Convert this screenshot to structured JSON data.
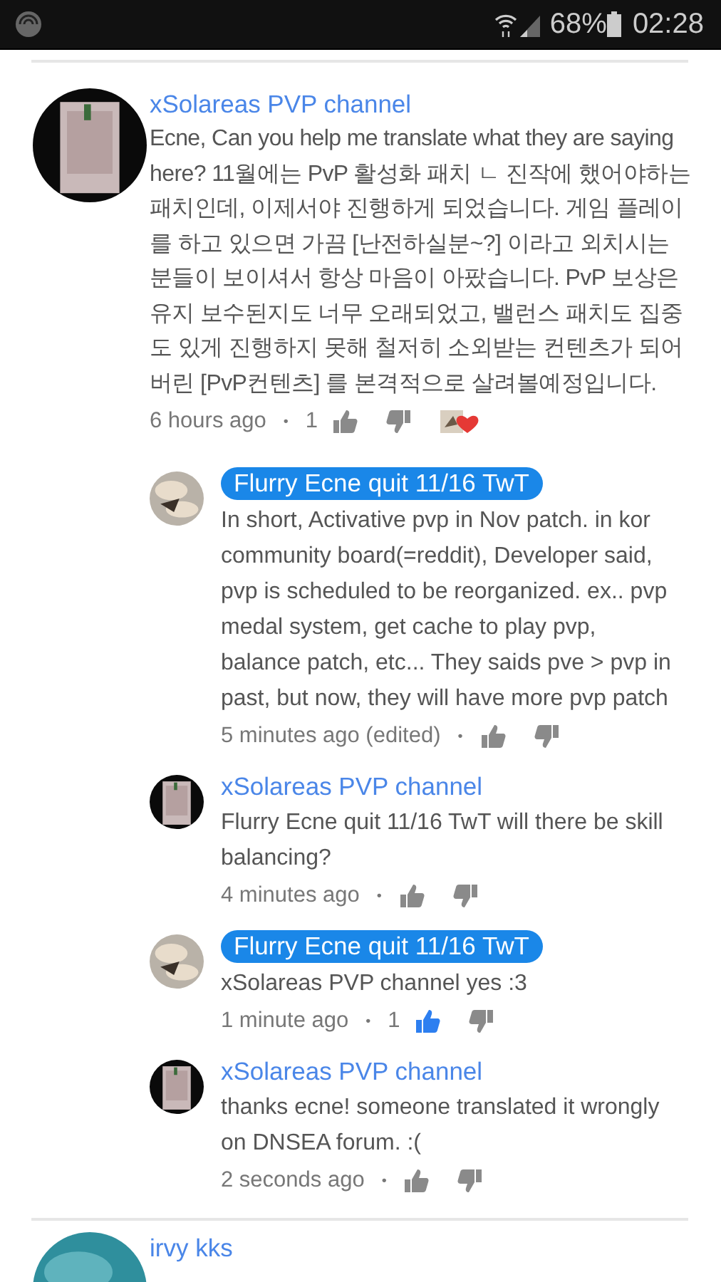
{
  "status_bar": {
    "battery": "68%",
    "time": "02:28"
  },
  "comments": [
    {
      "author": "xSolareas PVP channel",
      "author_highlighted": false,
      "text": "Ecne, Can you help me translate what they are saying here? 11월에는 PvP 활성화 패치 ㄴ 진작에 했어야하는 패치인데, 이제서야 진행하게 되었습니다. 게임 플레이를 하고 있으면 가끔 [난전하실분~?] 이라고 외치시는 분들이 보이셔서 항상 마음이 아팠습니다. PvP 보상은 유지 보수된지도 너무 오래되었고, 밸런스 패치도 집중도 있게 진행하지 못해 철저히 소외받는 컨텐츠가 되어버린 [PvP컨텐츠] 를 본격적으로 살려볼예정입니다.",
      "time": "6 hours ago",
      "separator": "•",
      "likes": "1",
      "liked": false,
      "creator_heart": true,
      "replies": [
        {
          "author": "Flurry Ecne quit 11/16 TwT",
          "author_highlighted": true,
          "text": "In short, Activative pvp in Nov patch. in kor community board(=reddit), Developer said, pvp is scheduled to be reorganized. ex.. pvp medal system, get cache to play pvp, balance patch, etc... They saids pve > pvp in past, but now, they will have more pvp patch",
          "time": "5 minutes ago (edited)",
          "separator": "•",
          "liked": false
        },
        {
          "author": "xSolareas PVP channel",
          "author_highlighted": false,
          "text": "Flurry Ecne quit 11/16 TwT will there be skill balancing?",
          "time": "4 minutes ago",
          "separator": "•",
          "liked": false
        },
        {
          "author": "Flurry Ecne quit 11/16 TwT",
          "author_highlighted": true,
          "text": "xSolareas PVP channel yes :3",
          "time": "1 minute ago",
          "separator": "•",
          "likes": "1",
          "liked": true
        },
        {
          "author": "xSolareas PVP channel",
          "author_highlighted": false,
          "text": "thanks ecne! someone translated it wrongly on DNSEA forum. :(",
          "time": "2 seconds ago",
          "separator": "•",
          "liked": false
        }
      ]
    },
    {
      "author": "irvy kks",
      "author_highlighted": false
    }
  ]
}
